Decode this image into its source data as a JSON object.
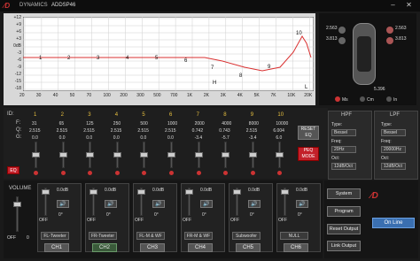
{
  "window": {
    "brand": "DYNAMICS",
    "title": "ADDSP46"
  },
  "graph": {
    "y_ticks": [
      "+12",
      "+9",
      "+6",
      "+3",
      "0dB",
      "-3",
      "-6",
      "-9",
      "-12",
      "-15",
      "-18"
    ],
    "x_ticks": [
      "20",
      "30",
      "40",
      "50",
      "70",
      "100",
      "200",
      "300",
      "500",
      "700",
      "1K",
      "2K",
      "3K",
      "4K",
      "5K",
      "7K",
      "10K",
      "20K"
    ],
    "point_labels": [
      "1",
      "2",
      "3",
      "4",
      "5",
      "6",
      "7",
      "8",
      "9",
      "10",
      "H",
      "L"
    ]
  },
  "car": {
    "ch1_delay": "2.563",
    "ch2_delay": "3.813",
    "ch3_delay": "2.563",
    "ch4_delay": "3.813",
    "rear_delay": "5.396",
    "units": [
      "Ms",
      "Cm",
      "In"
    ]
  },
  "eq": {
    "row_labels": {
      "id": "ID:",
      "f": "F:",
      "q": "Q:",
      "g": "G:"
    },
    "bands": [
      {
        "id": "1",
        "f": "31",
        "q": "2.515",
        "g": "0.0"
      },
      {
        "id": "2",
        "f": "65",
        "q": "2.515",
        "g": "0.0"
      },
      {
        "id": "3",
        "f": "125",
        "q": "2.515",
        "g": "0.0"
      },
      {
        "id": "4",
        "f": "250",
        "q": "2.515",
        "g": "0.0"
      },
      {
        "id": "5",
        "f": "500",
        "q": "2.515",
        "g": "0.0"
      },
      {
        "id": "6",
        "f": "1000",
        "q": "2.515",
        "g": "0.0"
      },
      {
        "id": "7",
        "f": "2000",
        "q": "0.742",
        "g": "-3.4"
      },
      {
        "id": "8",
        "f": "4000",
        "q": "0.743",
        "g": "-5.7"
      },
      {
        "id": "9",
        "f": "8000",
        "q": "2.515",
        "g": "-3.4"
      },
      {
        "id": "10",
        "f": "10000",
        "q": "6.004",
        "g": "6.0"
      }
    ],
    "eq_button": "EQ",
    "reset_eq": "RESET EQ",
    "peq_mode": "PEQ MODE"
  },
  "hpf": {
    "title": "HPF",
    "type_label": "Type:",
    "type": "Bessel",
    "freq_label": "Freq:",
    "freq": "20Hz",
    "oct_label": "Oct:",
    "oct": "12dB/Oct"
  },
  "lpf": {
    "title": "LPF",
    "type_label": "Type:",
    "type": "Bessel",
    "freq_label": "Freq:",
    "freq": "20000Hz",
    "oct_label": "Oct:",
    "oct": "12dB/Oct"
  },
  "volume": {
    "label": "VOLUME",
    "value": "0",
    "off": "OFF"
  },
  "channels": [
    {
      "name": "CH1",
      "gain": "0.0dB",
      "phase": "0°",
      "label": "FL-Tweeter",
      "off": "OFF"
    },
    {
      "name": "CH2",
      "gain": "0.0dB",
      "phase": "0°",
      "label": "FR-Tweeter",
      "off": "OFF"
    },
    {
      "name": "CH3",
      "gain": "0.0dB",
      "phase": "0°",
      "label": "FL-M & WF",
      "off": "OFF"
    },
    {
      "name": "CH4",
      "gain": "0.0dB",
      "phase": "0°",
      "label": "FR-M & WF",
      "off": "OFF"
    },
    {
      "name": "CH5",
      "gain": "0.0dB",
      "phase": "0°",
      "label": "Subwoofer",
      "off": "OFF"
    },
    {
      "name": "CH6",
      "gain": "0.0dB",
      "phase": "0°",
      "label": "NULL",
      "off": "OFF"
    }
  ],
  "right_buttons": {
    "system": "System",
    "program": "Program",
    "reset_output": "Reset Output",
    "link_output": "Link Output",
    "on_line": "On Line"
  },
  "colors": {
    "accent_red": "#c3202a",
    "curve": "#d93030",
    "grid": "#cfcfcf"
  }
}
